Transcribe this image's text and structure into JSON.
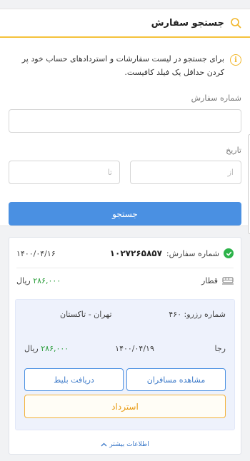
{
  "search": {
    "title": "جستجو سفارش",
    "info": "برای جستجو در لیست سفارشات و استردادهای حساب خود پر کردن حداقل یک فیلد کافیست.",
    "order_number_label": "شماره سفارش",
    "order_number_value": "",
    "date_label": "تاریخ",
    "date_from_placeholder": "از",
    "date_to_placeholder": "تا",
    "search_button": "جستجو"
  },
  "order": {
    "order_number_label": "شماره سفارش:",
    "order_number": "۱۰۲۷۲۶۵۸۵۷",
    "date": "۱۴۰۰/۰۴/۱۶",
    "vehicle": "قطار",
    "price_value": "۲۸۶,۰۰۰",
    "currency": "ریال",
    "status_color": "#2db34a",
    "booking": {
      "reservation_label": "شماره رزرو:",
      "reservation_number": "۴۶۰",
      "route": "تهران - تاکستان",
      "traveler": "رجا",
      "travel_date": "۱۴۰۰/۰۴/۱۹",
      "price_value": "۲۸۶,۰۰۰",
      "currency": "ریال",
      "view_passengers": "مشاهده مسافران",
      "get_ticket": "دریافت بلیط",
      "refund": "استرداد"
    },
    "more_info": "اطلاعات بیشتر"
  },
  "colors": {
    "accent": "#4a90e2",
    "warning": "#f1b629",
    "success": "#2db34a"
  }
}
